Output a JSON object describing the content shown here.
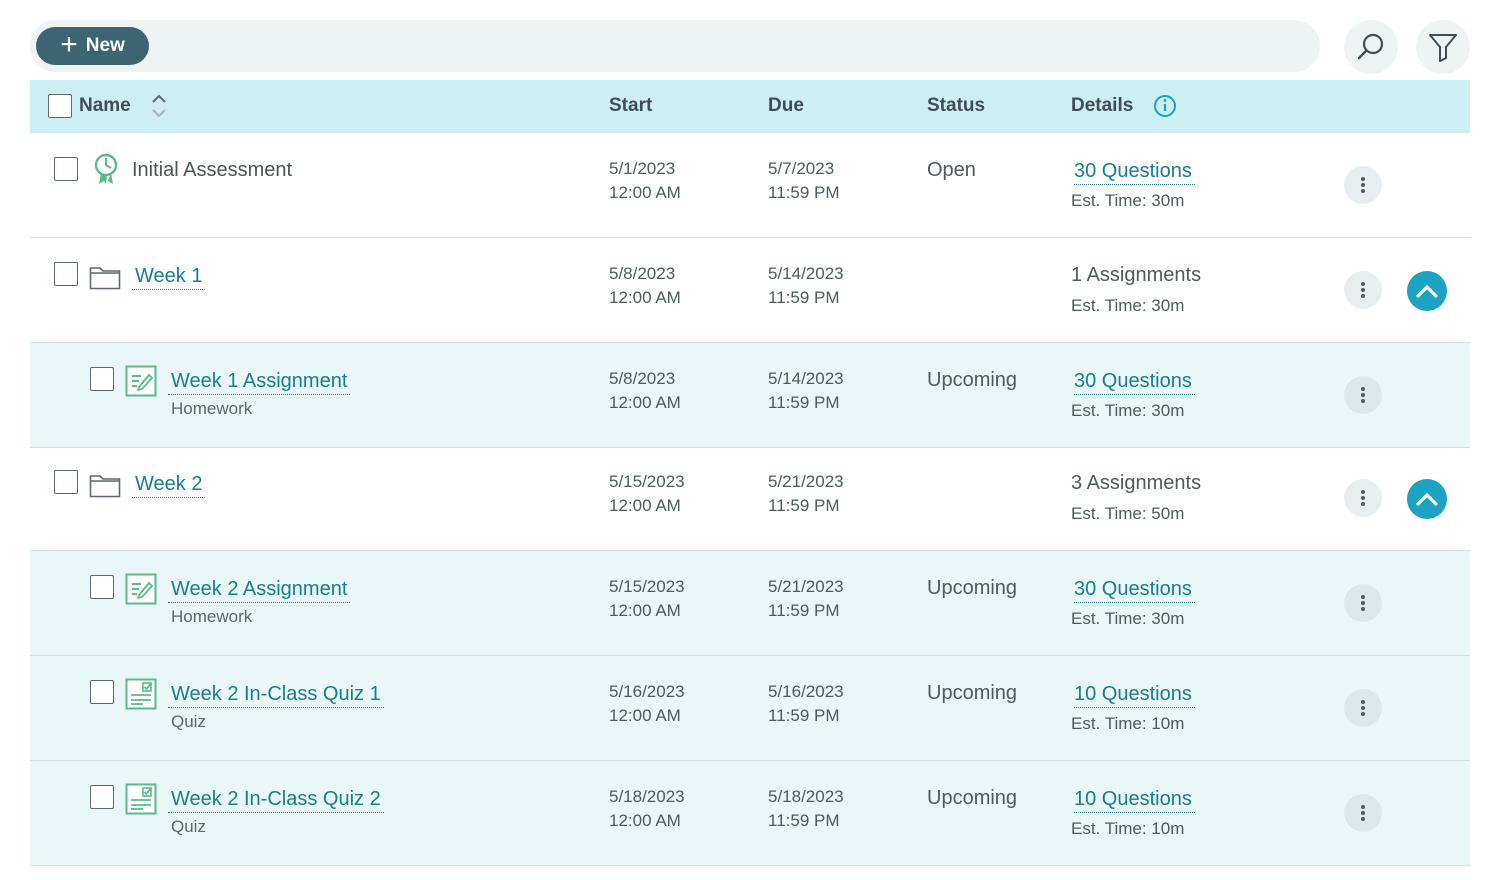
{
  "toolbar": {
    "new_label": "New",
    "search_icon": "search-icon",
    "filter_icon": "filter-icon"
  },
  "table": {
    "headers": {
      "name": "Name",
      "start": "Start",
      "due": "Due",
      "status": "Status",
      "details": "Details"
    },
    "rows": [
      {
        "name": "Initial Assessment",
        "icon": "assessment-badge-icon",
        "start_date": "5/1/2023",
        "start_time": "12:00 AM",
        "due_date": "5/7/2023",
        "due_time": "11:59 PM",
        "status": "Open",
        "details": "30 Questions",
        "est": "Est. Time: 30m"
      },
      {
        "name": "Week 1",
        "icon": "folder-icon",
        "start_date": "5/8/2023",
        "start_time": "12:00 AM",
        "due_date": "5/14/2023",
        "due_time": "11:59 PM",
        "status": "",
        "details": "1 Assignments",
        "est": "Est. Time: 30m"
      },
      {
        "name": "Week 1 Assignment",
        "type": "Homework",
        "icon": "homework-icon",
        "start_date": "5/8/2023",
        "start_time": "12:00 AM",
        "due_date": "5/14/2023",
        "due_time": "11:59 PM",
        "status": "Upcoming",
        "details": "30 Questions",
        "est": "Est. Time: 30m"
      },
      {
        "name": "Week 2",
        "icon": "folder-icon",
        "start_date": "5/15/2023",
        "start_time": "12:00 AM",
        "due_date": "5/21/2023",
        "due_time": "11:59 PM",
        "status": "",
        "details": "3 Assignments",
        "est": "Est. Time: 50m"
      },
      {
        "name": "Week 2 Assignment",
        "type": "Homework",
        "icon": "homework-icon",
        "start_date": "5/15/2023",
        "start_time": "12:00 AM",
        "due_date": "5/21/2023",
        "due_time": "11:59 PM",
        "status": "Upcoming",
        "details": "30 Questions",
        "est": "Est. Time: 30m"
      },
      {
        "name": "Week 2 In-Class Quiz 1",
        "type": "Quiz",
        "icon": "quiz-icon",
        "start_date": "5/16/2023",
        "start_time": "12:00 AM",
        "due_date": "5/16/2023",
        "due_time": "11:59 PM",
        "status": "Upcoming",
        "details": "10 Questions",
        "est": "Est. Time: 10m"
      },
      {
        "name": "Week 2 In-Class Quiz 2",
        "type": "Quiz",
        "icon": "quiz-icon",
        "start_date": "5/18/2023",
        "start_time": "12:00 AM",
        "due_date": "5/18/2023",
        "due_time": "11:59 PM",
        "status": "Upcoming",
        "details": "10 Questions",
        "est": "Est. Time: 10m"
      }
    ]
  },
  "colors": {
    "accent": "#197d8f",
    "new_button": "#3d6473",
    "header_bg": "#cdeef2",
    "child_row_bg": "#eaf7f8",
    "collapse_button": "#1aa3c3",
    "icon_green": "#5bb98c"
  }
}
